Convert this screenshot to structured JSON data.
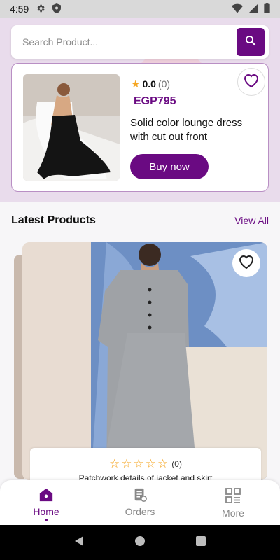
{
  "status_bar": {
    "time": "4:59"
  },
  "search": {
    "placeholder": "Search Product..."
  },
  "featured": {
    "rating": "0.0",
    "rating_count": "(0)",
    "price": "EGP795",
    "name": "Solid color lounge dress with cut out front",
    "buy_label": "Buy now"
  },
  "latest": {
    "title": "Latest Products",
    "view_all": "View All",
    "product": {
      "rating_count": "(0)",
      "stars": 0,
      "name": "Patchwork details of jacket and skirt"
    }
  },
  "bottom_nav": {
    "items": [
      {
        "label": "Home",
        "icon": "home-icon",
        "active": true
      },
      {
        "label": "Orders",
        "icon": "orders-icon",
        "active": false
      },
      {
        "label": "More",
        "icon": "more-grid-icon",
        "active": false
      }
    ]
  },
  "colors": {
    "primary": "#6a0a82",
    "star": "#f5a623",
    "hero_bg": "#e9dcec"
  }
}
